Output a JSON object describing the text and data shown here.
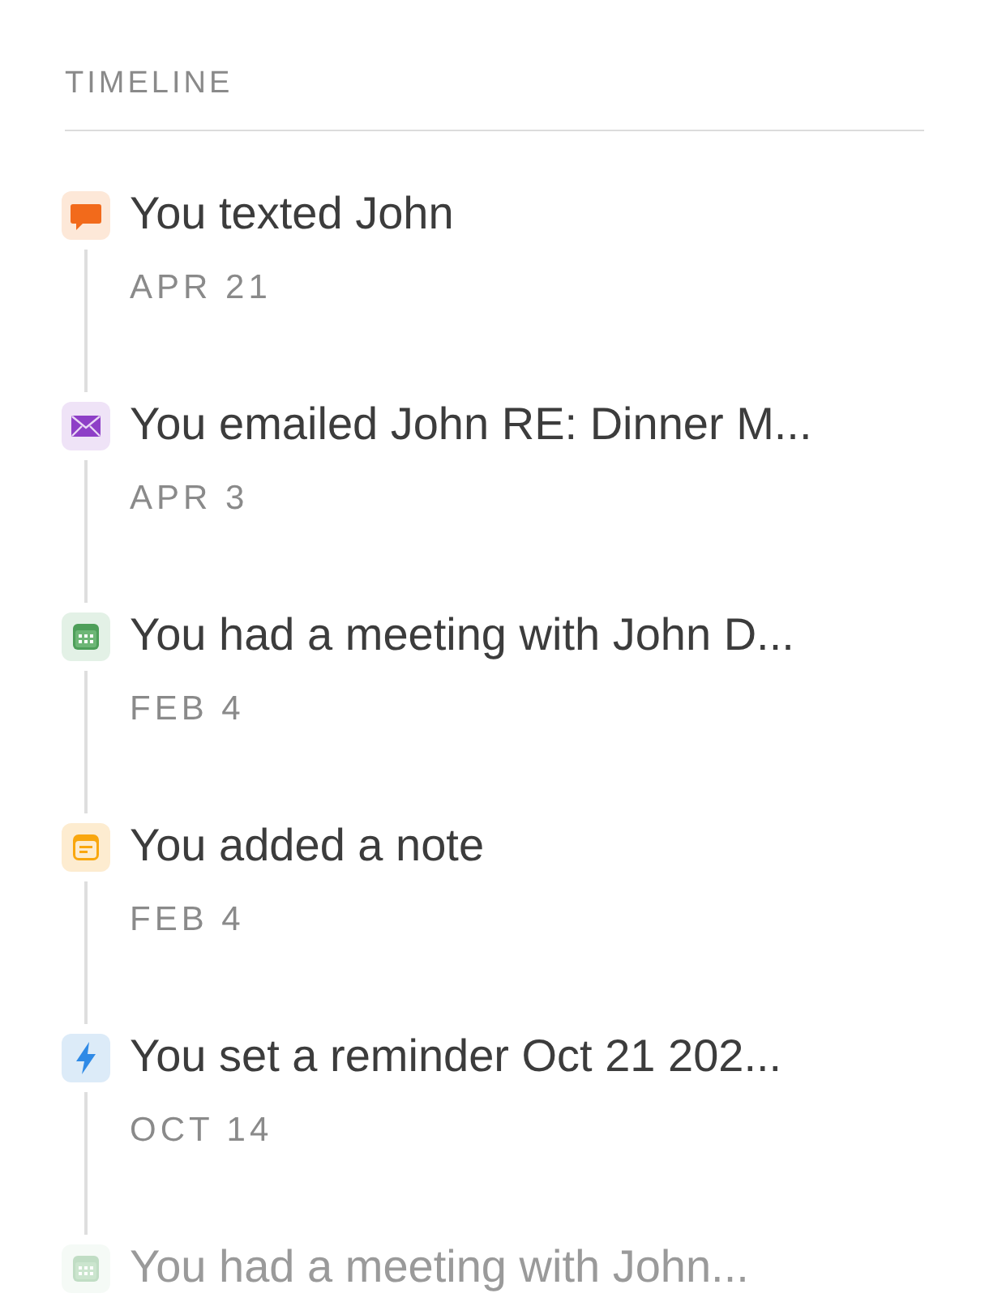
{
  "section": {
    "title": "TIMELINE"
  },
  "items": [
    {
      "kind": "text",
      "title": "You texted John",
      "date": "APR 21",
      "faded": false
    },
    {
      "kind": "email",
      "title": "You emailed John RE: Dinner M...",
      "date": "APR 3",
      "faded": false
    },
    {
      "kind": "meeting",
      "title": "You had a meeting with John D...",
      "date": "FEB 4",
      "faded": false
    },
    {
      "kind": "note",
      "title": "You added a note",
      "date": "FEB 4",
      "faded": false
    },
    {
      "kind": "reminder",
      "title": "You set a reminder Oct 21 202...",
      "date": "OCT 14",
      "faded": false
    },
    {
      "kind": "meeting",
      "title": "You had a meeting with John...",
      "faded": true
    }
  ]
}
